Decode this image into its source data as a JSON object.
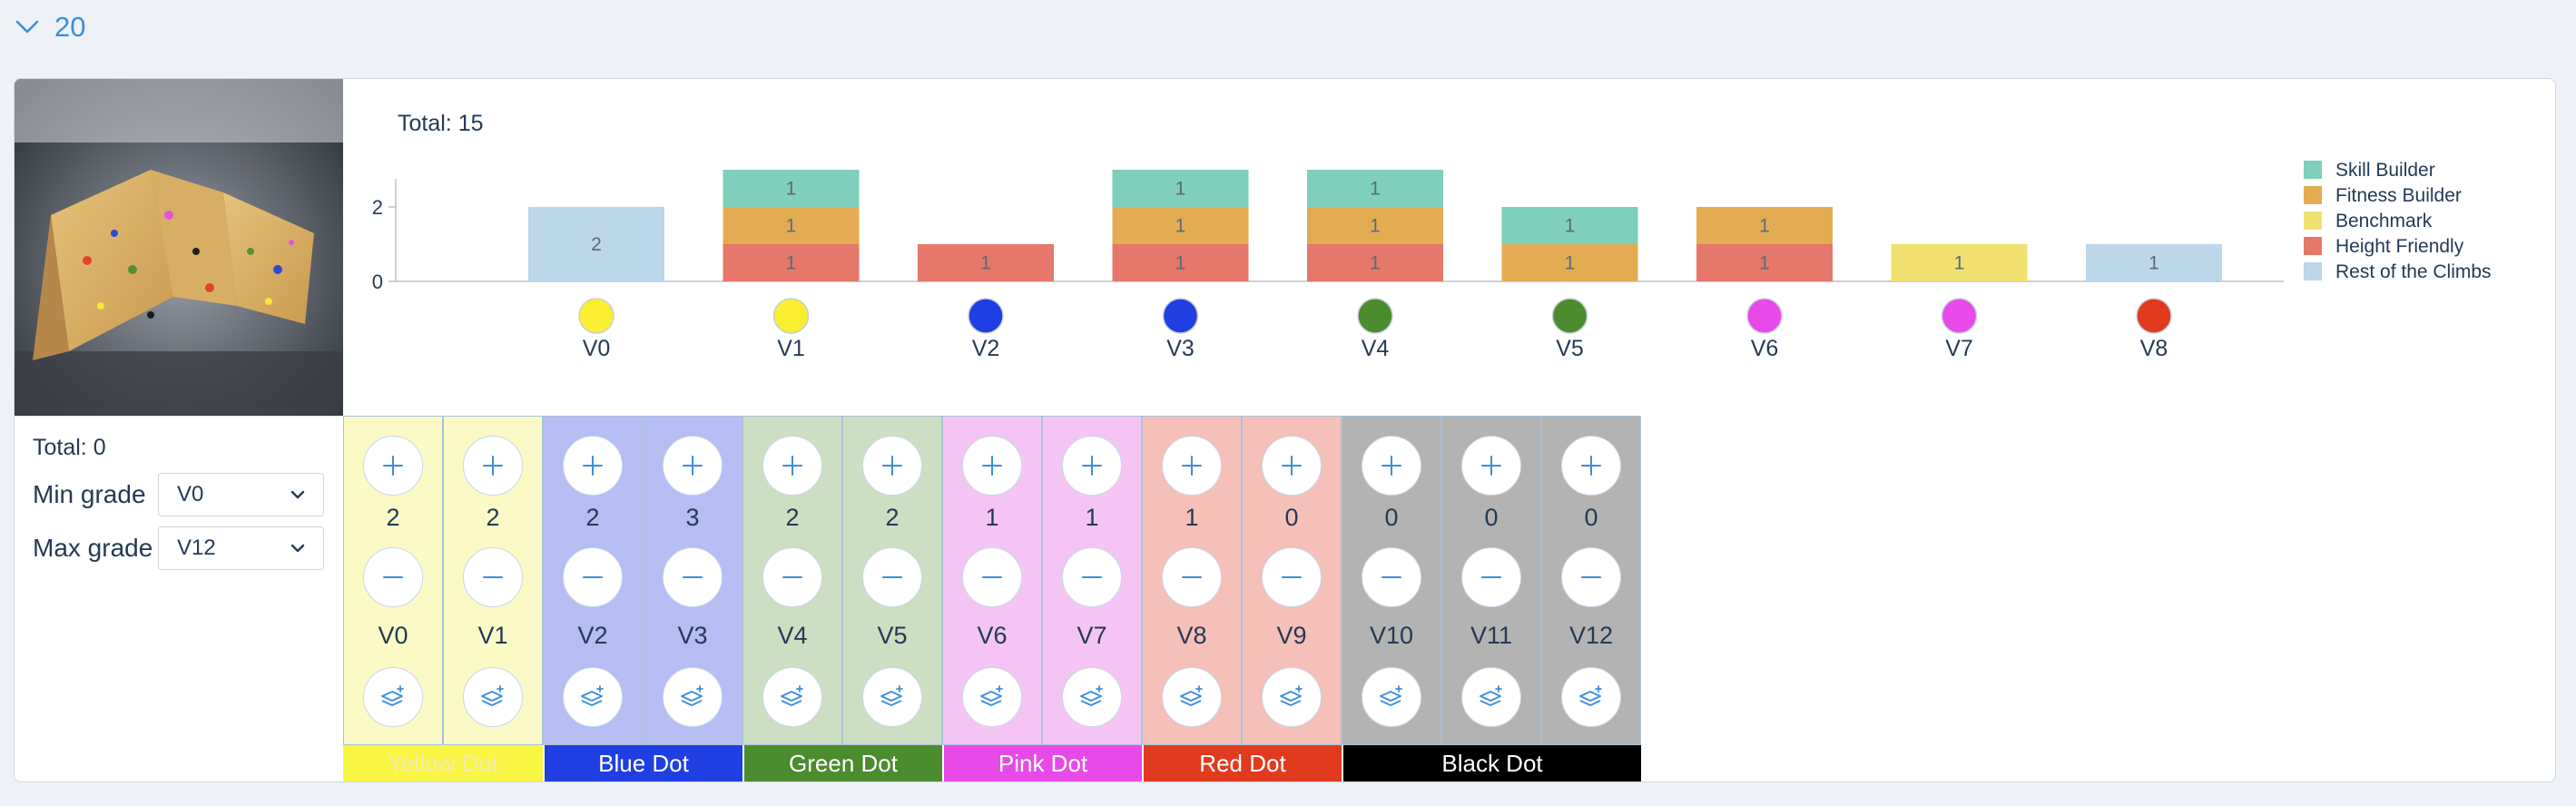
{
  "section": {
    "title": "20",
    "icon": "chevron-down-icon",
    "accent": "#3a8ee0"
  },
  "controls": {
    "total": "Total: 0",
    "min_grade_label": "Min grade",
    "min_grade_value": "V0",
    "max_grade_label": "Max grade",
    "max_grade_value": "V12"
  },
  "chart_data": {
    "type": "bar",
    "stacked": true,
    "title": "Total: 15",
    "categories": [
      "V0",
      "V1",
      "V2",
      "V3",
      "V4",
      "V5",
      "V6",
      "V7",
      "V8"
    ],
    "category_dot_colors": [
      "#f9ee2f",
      "#f9ee2f",
      "#1f3fe3",
      "#1f3fe3",
      "#4a8c2e",
      "#4a8c2e",
      "#e74ae8",
      "#e74ae8",
      "#e23a1f"
    ],
    "ylim": [
      0,
      3
    ],
    "yticks": [
      "0",
      "2"
    ],
    "series": [
      {
        "name": "Height Friendly",
        "color": "#e5786a",
        "values": [
          0,
          1,
          1,
          1,
          1,
          0,
          1,
          0,
          0
        ]
      },
      {
        "name": "Benchmark",
        "color": "#efe070",
        "values": [
          0,
          0,
          0,
          0,
          0,
          0,
          0,
          1,
          0
        ]
      },
      {
        "name": "Fitness Builder",
        "color": "#e3ac52",
        "values": [
          0,
          1,
          0,
          1,
          1,
          1,
          1,
          0,
          0
        ]
      },
      {
        "name": "Skill Builder",
        "color": "#7fcfbd",
        "values": [
          0,
          1,
          0,
          1,
          1,
          1,
          0,
          0,
          0
        ]
      },
      {
        "name": "Rest of the Climbs",
        "color": "#bcd6ea",
        "values": [
          2,
          0,
          0,
          0,
          0,
          0,
          0,
          0,
          1
        ]
      }
    ],
    "legend_order": [
      "Skill Builder",
      "Fitness Builder",
      "Benchmark",
      "Height Friendly",
      "Rest of the Climbs"
    ],
    "legend_position": "right",
    "grid": false
  },
  "grades": [
    {
      "label": "V0",
      "count": "2",
      "bg": "#fbf9c6"
    },
    {
      "label": "V1",
      "count": "2",
      "bg": "#fbf9c6"
    },
    {
      "label": "V2",
      "count": "2",
      "bg": "#b5bdf3"
    },
    {
      "label": "V3",
      "count": "3",
      "bg": "#b5bdf3"
    },
    {
      "label": "V4",
      "count": "2",
      "bg": "#ccdfc2"
    },
    {
      "label": "V5",
      "count": "2",
      "bg": "#ccdfc2"
    },
    {
      "label": "V6",
      "count": "1",
      "bg": "#f4c5f4"
    },
    {
      "label": "V7",
      "count": "1",
      "bg": "#f4c5f4"
    },
    {
      "label": "V8",
      "count": "1",
      "bg": "#f4c0b8"
    },
    {
      "label": "V9",
      "count": "0",
      "bg": "#f4c0b8"
    },
    {
      "label": "V10",
      "count": "0",
      "bg": "#b3b3b3"
    },
    {
      "label": "V11",
      "count": "0",
      "bg": "#b3b3b3"
    },
    {
      "label": "V12",
      "count": "0",
      "bg": "#b3b3b3"
    }
  ],
  "grade_icons": {
    "plus": "plus-icon",
    "minus": "minus-icon",
    "stack": "layers-add-icon"
  },
  "color_groups": [
    {
      "label": "Yellow Dot",
      "bg": "#f9f545",
      "fg": "#f1ecb0",
      "span": 2
    },
    {
      "label": "Blue Dot",
      "bg": "#1f3fe3",
      "fg": "#ffffff",
      "span": 2
    },
    {
      "label": "Green Dot",
      "bg": "#4a8c2e",
      "fg": "#ffffff",
      "span": 2
    },
    {
      "label": "Pink Dot",
      "bg": "#e74ae8",
      "fg": "#ffffff",
      "span": 2
    },
    {
      "label": "Red Dot",
      "bg": "#e23a1f",
      "fg": "#ffffff",
      "span": 2
    },
    {
      "label": "Black Dot",
      "bg": "#000000",
      "fg": "#ffffff",
      "span": 3
    }
  ]
}
